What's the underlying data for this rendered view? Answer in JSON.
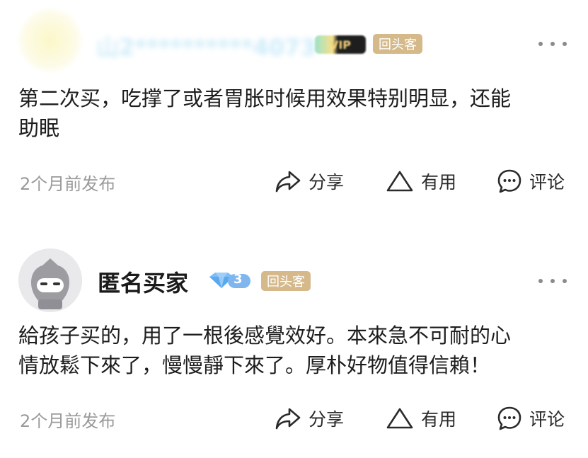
{
  "reviews": [
    {
      "username": "山2**********4073",
      "level": "VIP",
      "repeat_badge": "回头客",
      "content_lines": [
        "第二次买，吃撑了或者胃胀时候用效果特别明显，还能",
        "助眠"
      ],
      "time": "2个月前发布",
      "actions": {
        "share": "分享",
        "useful": "有用",
        "comment": "评论"
      }
    },
    {
      "username": "匿名买家",
      "level": "3",
      "repeat_badge": "回头客",
      "content_lines": [
        "給孩子买的，用了一根後感覺效好。本來急不可耐的心",
        "情放鬆下來了，慢慢靜下來了。厚朴好物值得信賴！"
      ],
      "time": "2个月前发布",
      "actions": {
        "share": "分享",
        "useful": "有用",
        "comment": "评论"
      }
    }
  ],
  "colors": {
    "repeat_badge": "#d5b98a",
    "muted_text": "#9a9a9a",
    "diamond": "#5aa9f0"
  }
}
